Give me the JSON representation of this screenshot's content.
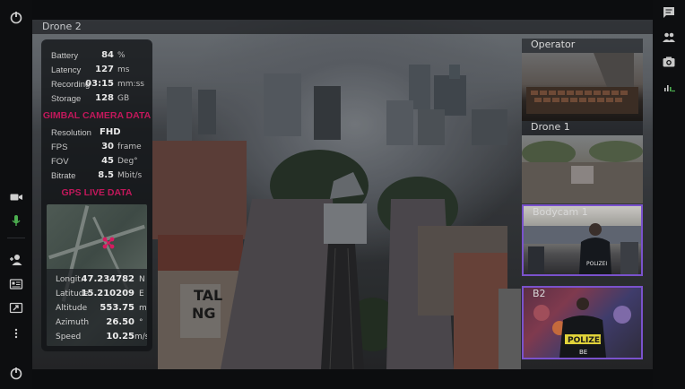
{
  "main_view": {
    "title": "Drone 2"
  },
  "telemetry": [
    {
      "label": "Battery",
      "value": "84",
      "unit": "%"
    },
    {
      "label": "Latency",
      "value": "127",
      "unit": "ms"
    },
    {
      "label": "Recording",
      "value": "03:15",
      "unit": "mm:ss"
    },
    {
      "label": "Storage",
      "value": "128",
      "unit": "GB"
    }
  ],
  "gimbal": {
    "heading": "GIMBAL CAMERA DATA",
    "rows": [
      {
        "label": "Resolution",
        "value": "FHD",
        "unit": ""
      },
      {
        "label": "FPS",
        "value": "30",
        "unit": "frame"
      },
      {
        "label": "FOV",
        "value": "45",
        "unit": "Deg°"
      },
      {
        "label": "Bitrate",
        "value": "8.5",
        "unit": "Mbit/s"
      }
    ]
  },
  "gps": {
    "heading": "GPS LIVE DATA",
    "rows": [
      {
        "label": "Longit.",
        "value": "47.234782",
        "unit": "N"
      },
      {
        "label": "Latitude",
        "value": "15.210209",
        "unit": "E"
      },
      {
        "label": "Altitude",
        "value": "553.75",
        "unit": "m"
      },
      {
        "label": "Azimuth",
        "value": "26.50",
        "unit": "°"
      },
      {
        "label": "Speed",
        "value": "10.25",
        "unit": "m/s"
      }
    ]
  },
  "feeds": [
    {
      "name": "Operator",
      "active": false
    },
    {
      "name": "Drone 1",
      "active": false
    },
    {
      "name": "Bodycam 1",
      "active": true,
      "overlay": "POLIZEI"
    },
    {
      "name": "B2",
      "active": true,
      "overlay": "POLIZEI",
      "sub": "BE"
    }
  ],
  "overlays": {
    "building_sign": "TAL NG"
  },
  "left_rail": [
    "power-icon",
    "video-camera-icon",
    "microphone-icon",
    "add-user-icon",
    "id-card-icon",
    "screen-share-icon",
    "more-icon",
    "logout-icon"
  ],
  "right_rail": [
    "chat-icon",
    "people-icon",
    "camera-icon",
    "signal-icon"
  ],
  "colors": {
    "accent": "#c2185b",
    "active_border": "#7a52cc",
    "mic_active": "#4caf50"
  }
}
